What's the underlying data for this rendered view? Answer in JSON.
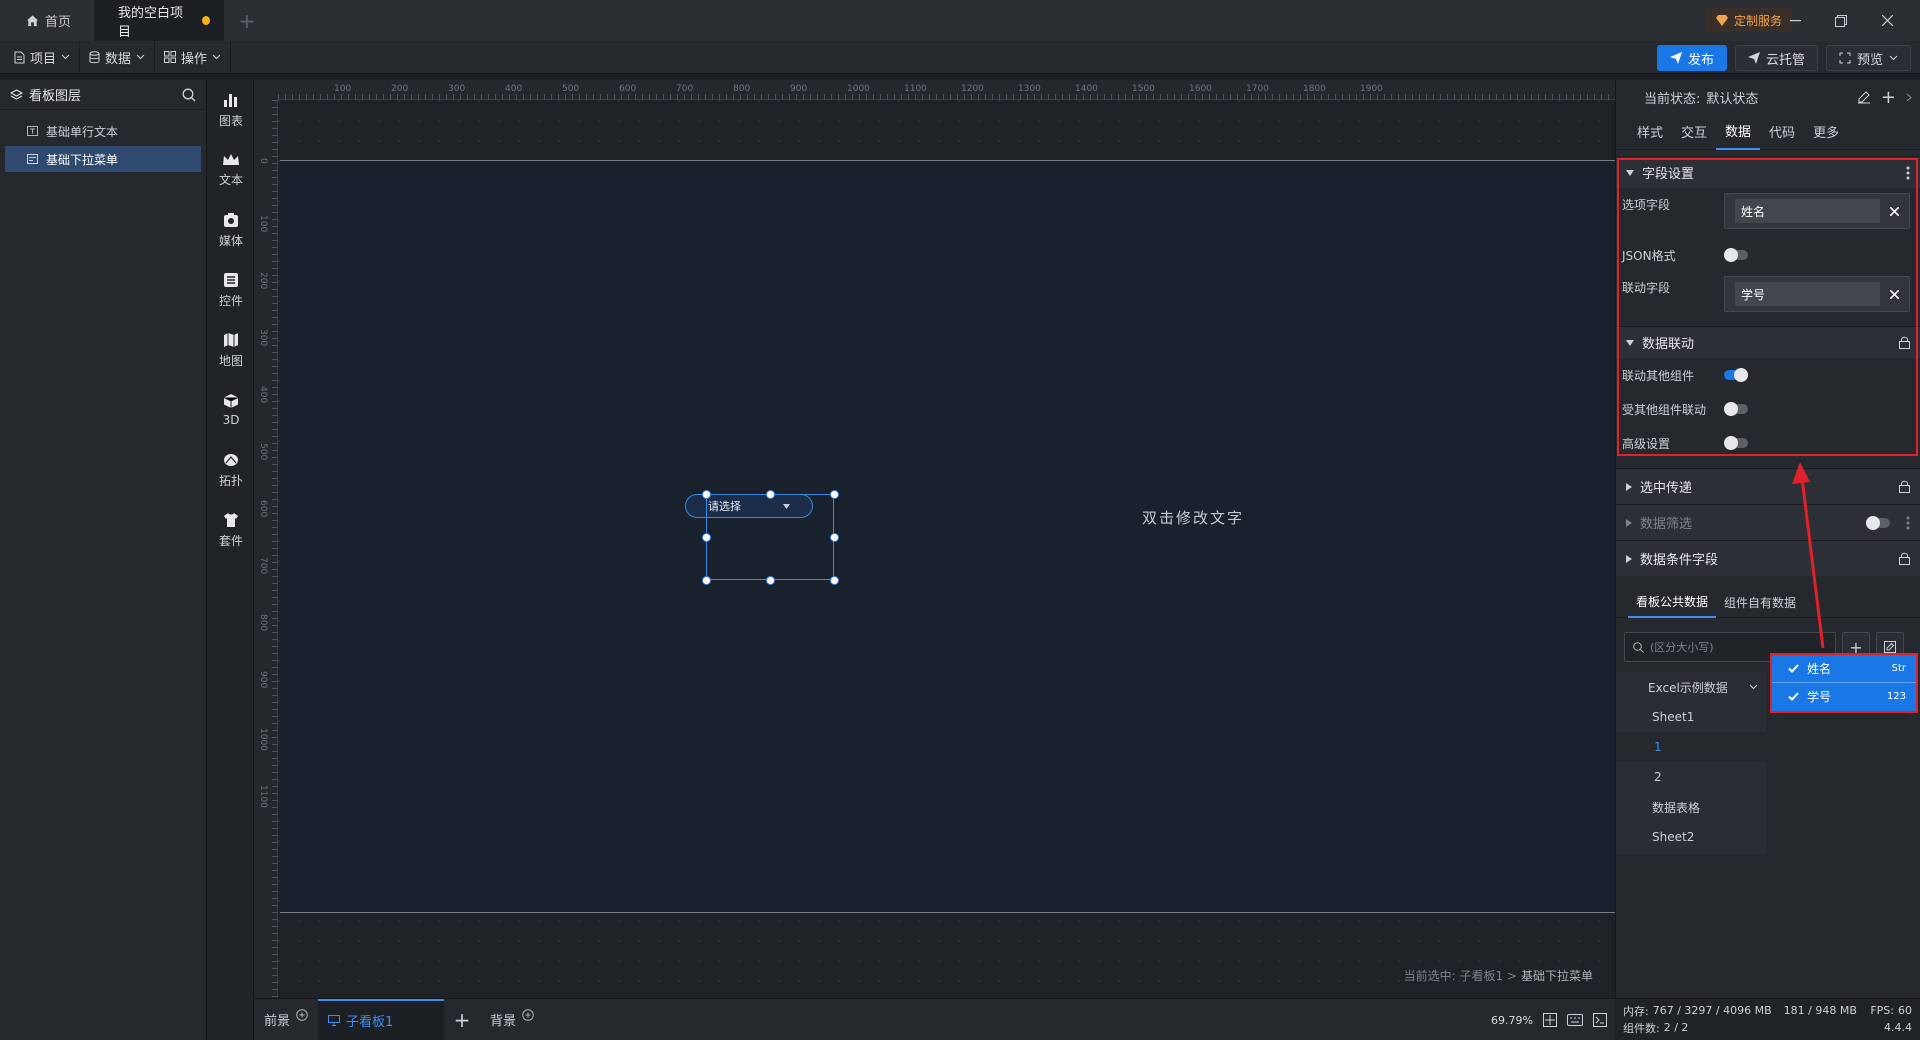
{
  "titlebar": {
    "home_tab": "首页",
    "project_tab": "我的空白项目",
    "custom_service": "定制服务"
  },
  "menubar": {
    "project": "项目",
    "data": "数据",
    "operation": "操作",
    "publish": "发布",
    "cloud_hosting": "云托管",
    "preview": "预览"
  },
  "layers": {
    "title": "看板图层",
    "items": [
      {
        "label": "基础单行文本",
        "selected": false
      },
      {
        "label": "基础下拉菜单",
        "selected": true
      }
    ]
  },
  "toolbox": [
    "图表",
    "文本",
    "媒体",
    "控件",
    "地图",
    "3D",
    "拓扑",
    "套件"
  ],
  "ruler": {
    "top": [
      "100",
      "200",
      "300",
      "400",
      "500",
      "600",
      "700",
      "800",
      "900",
      "1000",
      "1100",
      "1200",
      "1300",
      "1400",
      "1500",
      "1600",
      "1700",
      "1800",
      "1900"
    ],
    "left": [
      "0",
      "100",
      "200",
      "300",
      "400",
      "500",
      "600",
      "700",
      "800",
      "900",
      "1000",
      "1100"
    ]
  },
  "canvas": {
    "dropdown_placeholder": "请选择",
    "double_click_text": "双击修改文字",
    "current_selection_label": "当前选中: 子看板1 >",
    "current_selection_value": "基础下拉菜单"
  },
  "bottombar": {
    "foreground": "前景",
    "sub_board": "子看板1",
    "background": "背景",
    "zoom": "69.79%"
  },
  "right_panel": {
    "state_label": "当前状态:",
    "state_value": "默认状态",
    "tabs": [
      "样式",
      "交互",
      "数据",
      "代码",
      "更多"
    ],
    "active_tab": "数据",
    "field_settings": {
      "title": "字段设置",
      "option_field_label": "选项字段",
      "option_field_value": "姓名",
      "json_format_label": "JSON格式",
      "link_field_label": "联动字段",
      "link_field_value": "学号"
    },
    "data_linkage": {
      "title": "数据联动",
      "link_others": "联动其他组件",
      "linked_by_others": "受其他组件联动",
      "advanced": "高级设置"
    },
    "sections": [
      "选中传递",
      "数据筛选",
      "数据条件字段"
    ],
    "data_tabs": [
      "看板公共数据",
      "组件自有数据"
    ],
    "search_placeholder": "(区分大小写)",
    "tree": {
      "root": "Excel示例数据",
      "items": [
        "Sheet1",
        "1",
        "2",
        "数据表格",
        "Sheet2"
      ]
    },
    "fields": [
      {
        "name": "姓名",
        "type": "Str"
      },
      {
        "name": "学号",
        "type": "123"
      }
    ]
  },
  "status": {
    "memory_label": "内存:",
    "memory_value": "767 / 3297 / 4096 MB",
    "memory_value2": "181 / 948 MB",
    "fps_label": "FPS:",
    "fps_value": "60",
    "components_label": "组件数:",
    "components_value": "2 / 2",
    "version": "4.4.4"
  },
  "colors": {
    "accent": "#1a77e6",
    "highlight_red": "#e0202a",
    "modified_dot": "#f5b31b"
  }
}
